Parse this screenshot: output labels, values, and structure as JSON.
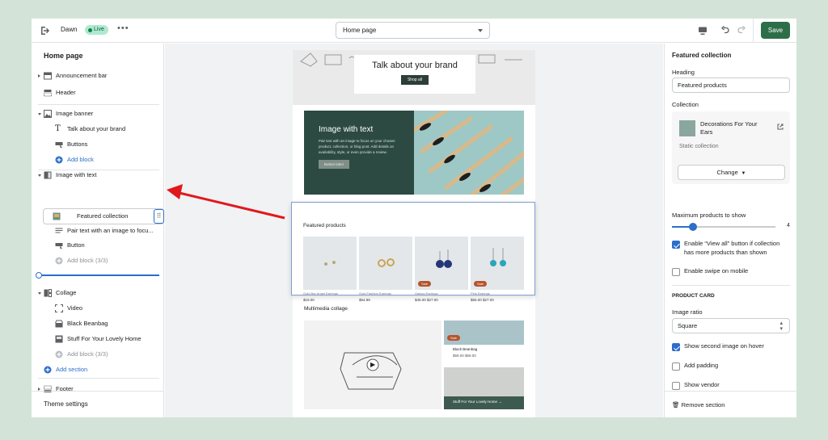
{
  "topbar": {
    "theme_name": "Dawn",
    "live_badge": "Live",
    "more_label": "•••",
    "page_select": "Home page",
    "save_label": "Save"
  },
  "sidebar": {
    "title": "Home page",
    "items": [
      {
        "label": "Announcement bar"
      },
      {
        "label": "Header"
      },
      {
        "label": "Image banner"
      },
      {
        "label": "Talk about your brand"
      },
      {
        "label": "Buttons"
      },
      {
        "label": "Add block"
      },
      {
        "label": "Image with text"
      },
      {
        "label": "Featured collection"
      },
      {
        "label": "Pair text with an image to focu..."
      },
      {
        "label": "Button"
      },
      {
        "label": "Add block (3/3)"
      },
      {
        "label": "Collage"
      },
      {
        "label": "Video"
      },
      {
        "label": "Black Beanbag"
      },
      {
        "label": "Stuff For Your Lovely Home"
      },
      {
        "label": "Add block (3/3)"
      },
      {
        "label": "Add section"
      },
      {
        "label": "Footer"
      }
    ],
    "theme_settings": "Theme settings"
  },
  "preview": {
    "brand_title": "Talk about your brand",
    "brand_button": "Shop all",
    "iwt_title": "Image with text",
    "iwt_body": "Pair text with an image to focus on your chosen product, collection, or blog post. Add details on availability, style, or even provide a review.",
    "iwt_button": "Button label",
    "fp_title": "Featured products",
    "products": [
      {
        "name": "Gold Bar Angel Earrings",
        "price": "$19.00",
        "sale": ""
      },
      {
        "name": "Gold Fashion Earrings",
        "price": "$54.99",
        "sale": ""
      },
      {
        "name": "Galaxy Earrings",
        "price": "$45.00  $27.00",
        "sale": "Sale"
      },
      {
        "name": "Pink Earrings",
        "price": "$55.00  $27.00",
        "sale": "Sale"
      }
    ],
    "mc_title": "Multimedia collage",
    "mc_card1_title": "Black Beanbag",
    "mc_card1_price": "$69.00  $69.00",
    "mc_card1_sale": "Sale",
    "mc_card2_title": "Stuff For Your Lovely Home →"
  },
  "settings": {
    "title": "Featured collection",
    "heading_label": "Heading",
    "heading_value": "Featured products",
    "collection_label": "Collection",
    "collection_name": "Decorations For Your Ears",
    "collection_type": "Static collection",
    "change_label": "Change",
    "max_label": "Maximum products to show",
    "max_value": "4",
    "max_fraction": 0.2,
    "enable_view_all": "Enable “View all” button if collection has more products than shown",
    "enable_swipe": "Enable swipe on mobile",
    "product_card_head": "PRODUCT CARD",
    "ratio_label": "Image ratio",
    "ratio_value": "Square",
    "show_second": "Show second image on hover",
    "add_padding": "Add padding",
    "show_vendor": "Show vendor",
    "remove_section": "Remove section"
  },
  "colors": {
    "save": "#2d6e48",
    "accent": "#2c6ecb",
    "pointer": "#e0191e",
    "background": "#d4e3d8"
  }
}
